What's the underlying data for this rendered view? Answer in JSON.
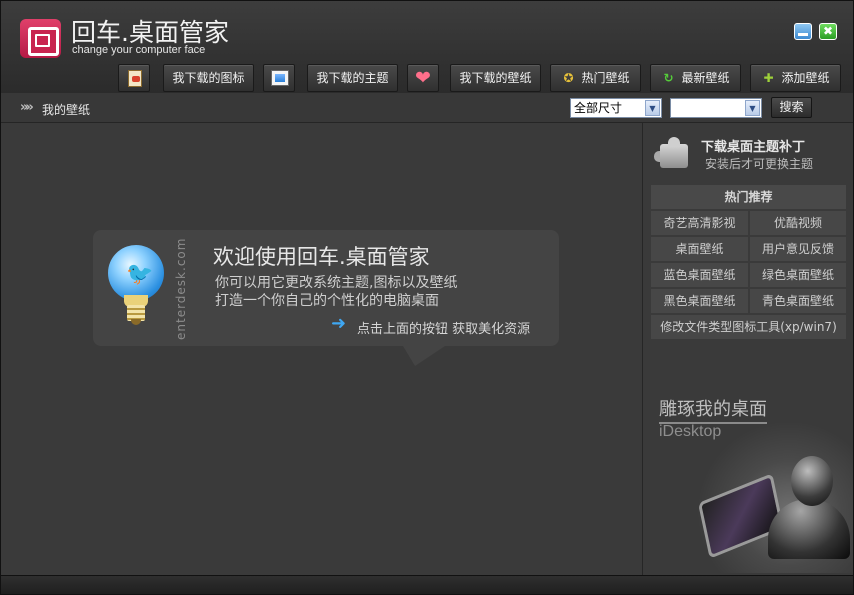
{
  "app": {
    "title": "回车.桌面管家",
    "subtitle": "change your computer face"
  },
  "window_controls": {
    "close_glyph": "✖"
  },
  "toolbar": {
    "items": [
      {
        "label": "",
        "icon": "document-icon"
      },
      {
        "label": "我下载的图标",
        "icon": null
      },
      {
        "label": "",
        "icon": "image-icon"
      },
      {
        "label": "我下载的主题",
        "icon": null
      },
      {
        "label": "",
        "icon": "heart-icon"
      },
      {
        "label": "我下载的壁纸",
        "icon": null
      },
      {
        "label": "热门壁纸",
        "icon": "award-ribbon-icon"
      },
      {
        "label": "最新壁纸",
        "icon": "refresh-icon"
      },
      {
        "label": "添加壁纸",
        "icon": "plus-icon"
      }
    ],
    "heart_glyph": "❤",
    "hot_glyph": "✪",
    "new_glyph": "↻",
    "add_glyph": "✚"
  },
  "breadcrumb": {
    "arrow": "»»",
    "label": "我的壁纸"
  },
  "filters": {
    "size_select": "全部尺寸",
    "second_select": "",
    "dropdown_glyph": "▼",
    "search_label": "搜索"
  },
  "welcome": {
    "watermark": "enterdesk.com",
    "title": "欢迎使用回车.桌面管家",
    "line1": "你可以用它更改系统主题,图标以及壁纸",
    "line2": "打造一个你自己的个性化的电脑桌面",
    "arrow": "➜",
    "hint": "点击上面的按钮 获取美化资源",
    "bird_glyph": "🐦"
  },
  "sidebar": {
    "patch_title": "下载桌面主题补丁",
    "patch_sub": "安装后才可更换主题",
    "hot_header": "热门推荐",
    "hot_items": [
      "奇艺高清影视",
      "优酷视频",
      "桌面壁纸",
      "用户意见反馈",
      "蓝色桌面壁纸",
      "绿色桌面壁纸",
      "黑色桌面壁纸",
      "青色桌面壁纸",
      "修改文件类型图标工具(xp/win7)"
    ],
    "brand_cn": "雕琢我的桌面",
    "brand_en": "iDesktop"
  },
  "colors": {
    "accent_pink": "#c8244f",
    "accent_blue": "#3fa7f2",
    "background": "#3a3a3a"
  }
}
